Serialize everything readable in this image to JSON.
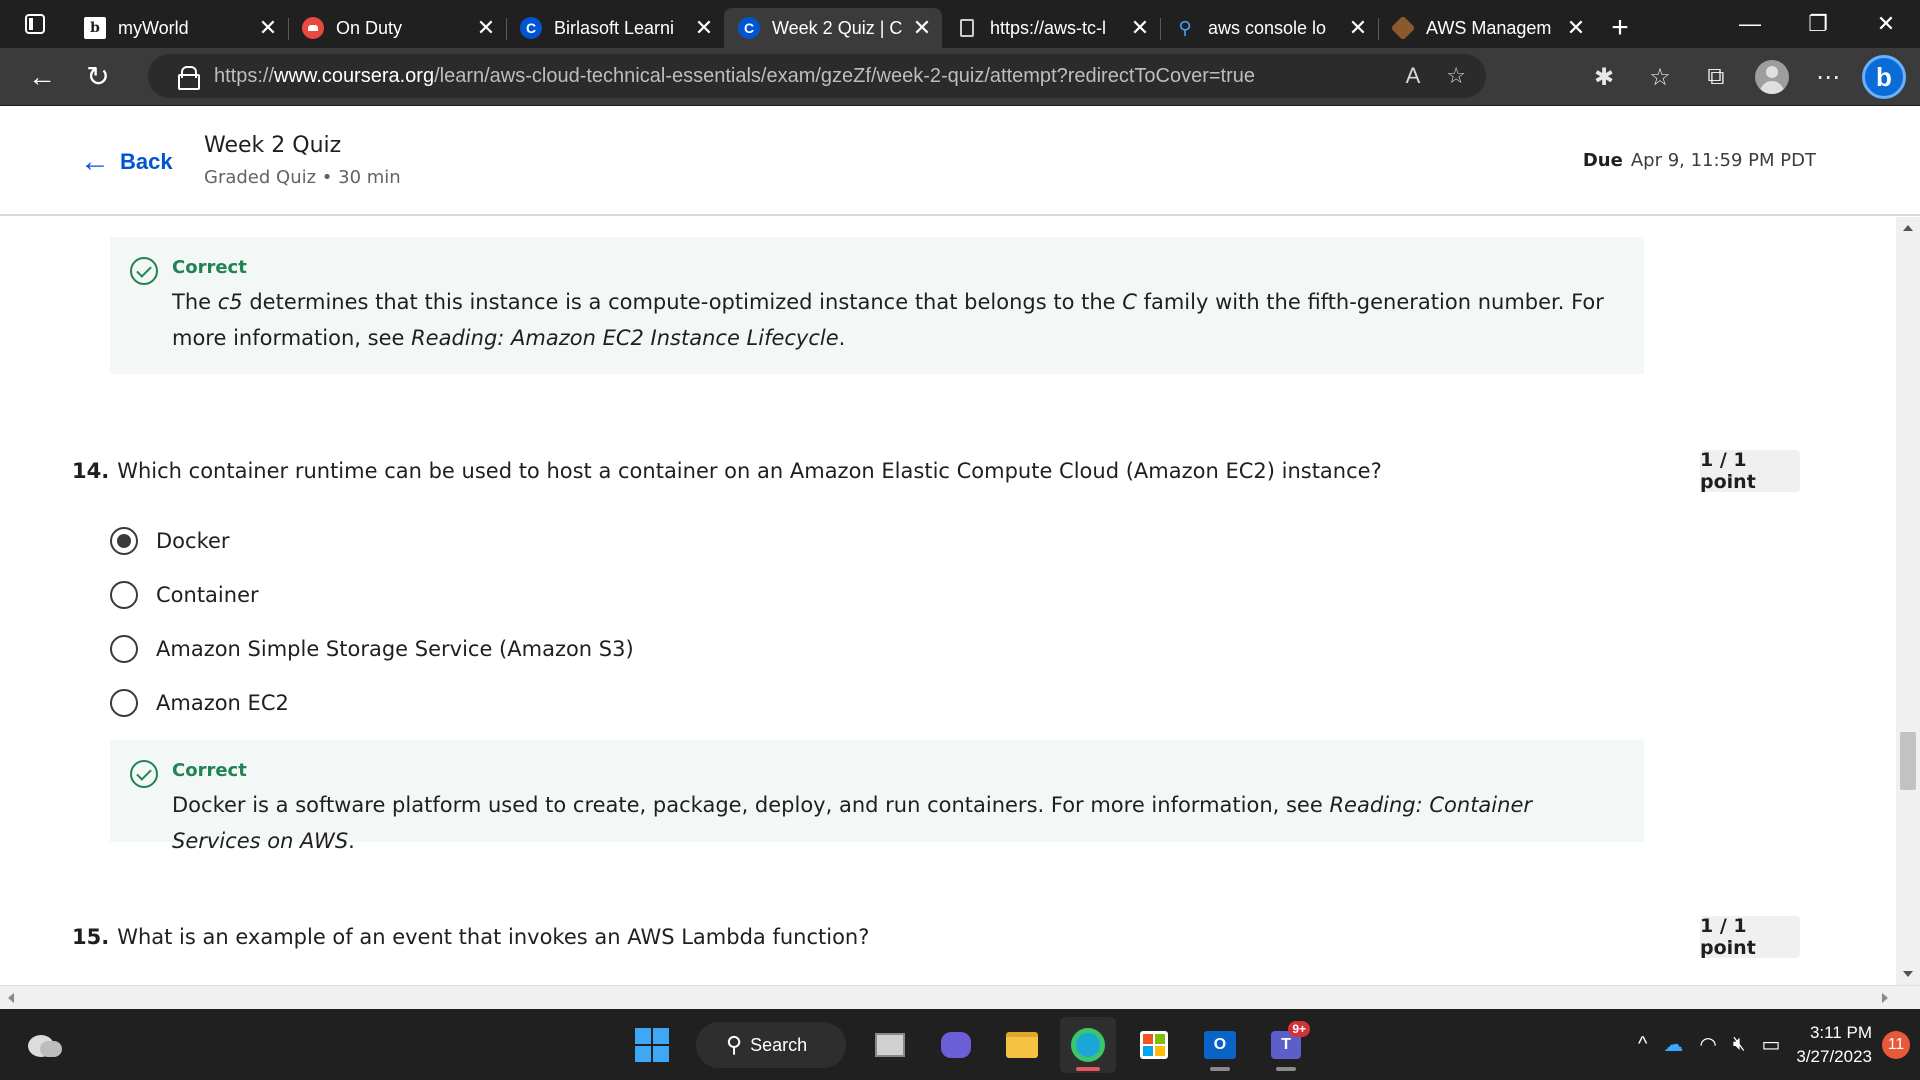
{
  "browser": {
    "tabs": [
      {
        "title": "myWorld",
        "icon": "b-icon",
        "icon_text": "b",
        "active": false
      },
      {
        "title": "On Duty",
        "icon": "onduty-icon",
        "icon_text": "",
        "active": false
      },
      {
        "title": "Birlasoft Learni",
        "icon": "coursera-icon",
        "icon_text": "C",
        "active": false
      },
      {
        "title": "Week 2 Quiz | C",
        "icon": "coursera-icon",
        "icon_text": "C",
        "active": true
      },
      {
        "title": "https://aws-tc-l",
        "icon": "page-icon",
        "icon_text": "",
        "active": false
      },
      {
        "title": "aws console lo",
        "icon": "search-icon",
        "icon_text": "",
        "active": false
      },
      {
        "title": "AWS Managem",
        "icon": "aws-cube-icon",
        "icon_text": "",
        "active": false
      }
    ],
    "url_prefix": "https://",
    "url_host": "www.coursera.org",
    "url_path": "/learn/aws-cloud-technical-essentials/exam/gzeZf/week-2-quiz/attempt?redirectToCover=true",
    "bing_letter": "b"
  },
  "header": {
    "back_label": "Back",
    "title": "Week 2 Quiz",
    "subtitle": "Graded Quiz • 30 min",
    "due_label": "Due",
    "due_value": "Apr 9, 11:59 PM PDT"
  },
  "feedback13": {
    "label": "Correct",
    "t1": "The ",
    "t2": "c5",
    "t3": " determines that this instance is a compute-optimized instance that belongs to the ",
    "t4": "C",
    "t5": " family with the fifth-generation number. For more information, see ",
    "t6": "Reading: Amazon EC2 Instance Lifecycle",
    "t7": "."
  },
  "q14": {
    "number": "14.",
    "text": "Which container runtime can be used to host a container on an Amazon Elastic Compute Cloud (Amazon EC2) instance?",
    "points": "1 / 1 point",
    "options": [
      "Docker",
      "Container",
      "Amazon Simple Storage Service (Amazon S3)",
      "Amazon EC2"
    ],
    "selected_index": 0,
    "feedback_label": "Correct",
    "feedback_text": "Docker is a software platform used to create, package, deploy, and run containers. For more information, see ",
    "feedback_link": "Reading: Container Services on AWS",
    "feedback_end": "."
  },
  "q15": {
    "number": "15.",
    "text": "What is an example of an event that invokes an AWS Lambda function?",
    "points": "1 / 1 point"
  },
  "taskbar": {
    "search_label": "Search",
    "teams_badge": "9+",
    "time": "3:11 PM",
    "date": "3/27/2023",
    "notifications": "11"
  }
}
